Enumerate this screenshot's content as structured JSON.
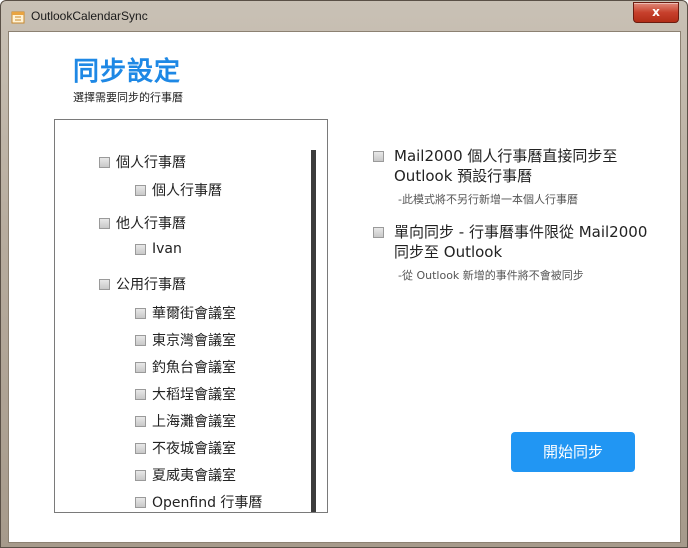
{
  "window": {
    "title": "OutlookCalendarSync",
    "close_label": "x"
  },
  "page": {
    "heading": "同步設定",
    "subheading": "選擇需要同步的行事曆"
  },
  "tree": {
    "groups": [
      {
        "label": "個人行事曆",
        "items": [
          "個人行事曆"
        ]
      },
      {
        "label": "他人行事曆",
        "items": [
          "Ivan"
        ]
      },
      {
        "label": "公用行事曆",
        "items": [
          "華爾街會議室",
          "東京灣會議室",
          "釣魚台會議室",
          "大稻埕會議室",
          "上海灘會議室",
          "不夜城會議室",
          "夏威夷會議室",
          "Openfind 行事曆"
        ]
      }
    ]
  },
  "options": [
    {
      "label_line1": "Mail2000 個人行事曆直接同步至",
      "label_line2": "Outlook 預設行事曆",
      "note": "-此模式將不另行新增一本個人行事曆"
    },
    {
      "label_line1": "單向同步 - 行事曆事件限從 Mail2000",
      "label_line2": "同步至 Outlook",
      "note": "-從 Outlook 新增的事件將不會被同步"
    }
  ],
  "actions": {
    "start_label": "開始同步"
  },
  "colors": {
    "accent": "#2196f3",
    "heading": "#1e88e5"
  }
}
